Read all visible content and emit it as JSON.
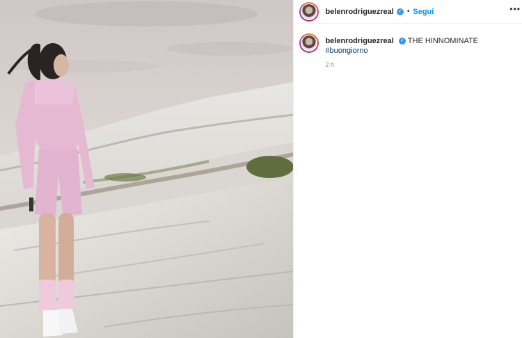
{
  "post": {
    "author": "belenrodriguezreal",
    "follow_label": "Segui",
    "separator": "•",
    "more_icon": "•••",
    "verified_glyph": "✓",
    "caption_text": "THE HINNOMINATE",
    "caption_hashtag": "#buongiorno",
    "timestamp": "2 h"
  },
  "icons": {
    "verified": "verified-badge-icon",
    "more": "more-options-icon"
  },
  "colors": {
    "link_blue": "#0095f6",
    "verified_blue": "#3897f0",
    "hashtag": "#00376b",
    "text": "#262626",
    "muted": "#8e8e8e"
  }
}
